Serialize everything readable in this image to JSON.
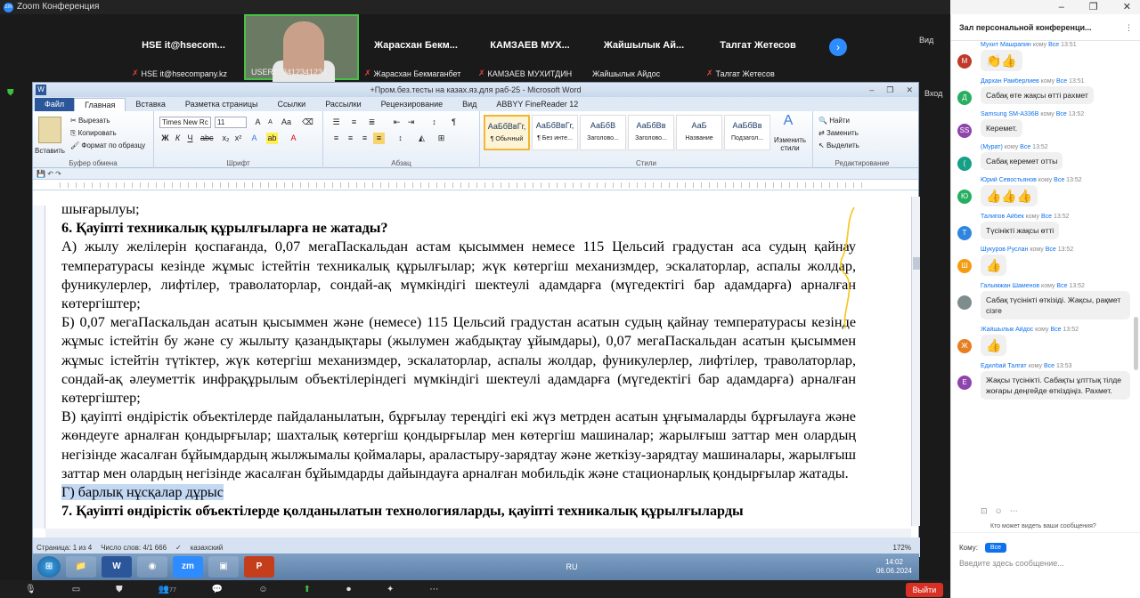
{
  "zoom": {
    "title": "Zoom Конференция",
    "view_label": "Вид",
    "exit_label": "Вход"
  },
  "participants": [
    {
      "name": "HSE  it@hsecom...",
      "label": "HSE  it@hsecompany.kz",
      "muted": true
    },
    {
      "name": "",
      "label": "USER123412341234",
      "muted": false,
      "video": true
    },
    {
      "name": "Жарасхан  Бекм...",
      "label": "Жарасхан Бекмаганбет",
      "muted": true
    },
    {
      "name": "КАМЗАЕВ  МУХ...",
      "label": "КАМЗАЕВ МУХИТДИН",
      "muted": true
    },
    {
      "name": "Жайшылык  Ай...",
      "label": "Жайшылык Айдос",
      "muted": false
    },
    {
      "name": "Талгат Жетесов",
      "label": "Талгат Жетесов",
      "muted": true
    }
  ],
  "word": {
    "title": "+Пром.без.тесты на казах.яз.для раб-25  -  Microsoft Word",
    "tabs": [
      "Файл",
      "Главная",
      "Вставка",
      "Разметка страницы",
      "Ссылки",
      "Рассылки",
      "Рецензирование",
      "Вид",
      "ABBYY FineReader 12"
    ],
    "clipboard": {
      "paste": "Вставить",
      "cut": "Вырезать",
      "copy": "Копировать",
      "format": "Формат по образцу",
      "group": "Буфер обмена"
    },
    "font": {
      "name": "Times New Rc",
      "size": "11",
      "group": "Шрифт"
    },
    "paragraph_group": "Абзац",
    "styles": [
      {
        "preview": "АаБбВвГг,",
        "name": "¶ Обычный",
        "selected": true
      },
      {
        "preview": "АаБбВвГг,",
        "name": "¶ Без инте...",
        "selected": false
      },
      {
        "preview": "АаБбВ",
        "name": "Заголово...",
        "selected": false
      },
      {
        "preview": "АаБбВв",
        "name": "Заголово...",
        "selected": false
      },
      {
        "preview": "АаБ",
        "name": "Название",
        "selected": false
      },
      {
        "preview": "АаБбВв",
        "name": "Подзагол...",
        "selected": false
      }
    ],
    "styles_group": "Стили",
    "change_styles": "Изменить стили",
    "editing": {
      "find": "Найти",
      "replace": "Заменить",
      "select": "Выделить",
      "group": "Редактирование"
    },
    "document": {
      "lines": [
        {
          "text": "шығарылуы;",
          "bold": false
        },
        {
          "text": "6. Қауіпті техникалық құрылғыларға не жатады?",
          "bold": true
        },
        {
          "text": "А) жылу желілерін қоспағанда, 0,07 мегаПаскальдан астам қысыммен немесе 115 Цельсий градустан аса судың қайнау температурасы кезінде жұмыс істейтін техникалық құрылғылар; жүк көтергіш механизмдер, эскалаторлар, аспалы жолдар, фуникулерлер, лифтілер, траволаторлар, сондай-ақ мүмкіндігі шектеулі адамдарға (мүгедектігі бар адамдарға) арналған көтергіштер;",
          "bold": false
        },
        {
          "text": "Б) 0,07 мегаПаскальдан асатын қысыммен және (немесе) 115 Цельсий градустан асатын судың қайнау температурасы кезінде жұмыс істейтін бу және су жылыту қазандықтары (жылумен жабдықтау ұйымдары), 0,07 мегаПаскальдан асатын қысыммен жұмыс істейтін түтіктер, жүк көтергіш механизмдер, эскалаторлар, аспалы жолдар, фуникулерлер, лифтілер, траволаторлар, сондай-ақ әлеуметтік инфрақұрылым объектілеріндегі мүмкіндігі шектеулі адамдарға (мүгедектігі бар адамдарға) арналған көтергіштер;",
          "bold": false
        },
        {
          "text": "В) қауіпті өндірістік объектілерде пайдаланылатын, бұрғылау тереңдігі екі жүз метрден асатын ұңғымаларды бұрғылауға және жөндеуге арналған қондырғылар; шахталық көтергіш қондырғылар мен көтергіш машиналар; жарылғыш заттар мен олардың негізінде жасалған бұйымдардың жылжымалы қоймалары, араластыру-зарядтау және жеткізу-зарядтау машиналары, жарылғыш заттар мен олардың негізінде жасалған бұйымдарды дайындауға арналған мобильдік және стационарлық қондырғылар жатады.",
          "bold": false
        },
        {
          "text": "Г) барлық нұсқалар дұрыс",
          "bold": false,
          "highlight": true
        },
        {
          "text": "7. Қауіпті өндірістік объектілерде қолданылатын технологияларды, қауіпті техникалық құрылғыларды",
          "bold": true
        }
      ]
    },
    "status": {
      "page": "Страница: 1 из 4",
      "words": "Число слов: 4/1 666",
      "lang": "казахский",
      "zoom": "172%"
    }
  },
  "taskbar": {
    "apps": [
      "",
      "",
      "W",
      "",
      "zm",
      "",
      "P"
    ],
    "lang": "RU",
    "time": "14:02",
    "date": "06.06.2024"
  },
  "zoom_toolbar": {
    "participants_count": "77",
    "exit": "Выйти"
  },
  "chat": {
    "title": "Зал персональной конференци...",
    "messages": [
      {
        "sender": "Мухит Машрапин",
        "to": "кому",
        "all": "Все",
        "time": "13:51",
        "avatar": "М",
        "color": "#c0392b",
        "text": "👏👍",
        "emoji": true
      },
      {
        "sender": "Дархан Рамберлиев",
        "to": "кому",
        "all": "Все",
        "time": "13:51",
        "avatar": "Д",
        "color": "#27ae60",
        "text": "Сабақ өте жақсы өтті рахмет",
        "emoji": false
      },
      {
        "sender": "Samsung SM-A336B",
        "to": "кому",
        "all": "Все",
        "time": "13:52",
        "avatar": "SS",
        "color": "#8e44ad",
        "text": "Керемет.",
        "emoji": false
      },
      {
        "sender": "(Мурат)",
        "to": "кому",
        "all": "Все",
        "time": "13:52",
        "avatar": "(",
        "color": "#16a085",
        "text": "Сабақ керемет отты",
        "emoji": false
      },
      {
        "sender": "Юрий Севостьянов",
        "to": "кому",
        "all": "Все",
        "time": "13:52",
        "avatar": "Ю",
        "color": "#27ae60",
        "text": "👍👍👍",
        "emoji": true
      },
      {
        "sender": "Талипов Айбек",
        "to": "кому",
        "all": "Все",
        "time": "13:52",
        "avatar": "Т",
        "color": "#2e86de",
        "text": "Түсінікті жақсы өтті",
        "emoji": false
      },
      {
        "sender": "Шукуров Руслан",
        "to": "кому",
        "all": "Все",
        "time": "13:52",
        "avatar": "Ш",
        "color": "#f39c12",
        "text": "👍",
        "emoji": true
      },
      {
        "sender": "Галымжан Шаменов",
        "to": "кому",
        "all": "Все",
        "time": "13:52",
        "avatar": "",
        "color": "#7f8c8d",
        "text": "Сабақ түсінікті өткізіді. Жақсы, рақмет сізге",
        "emoji": false
      },
      {
        "sender": "Жайшылык Айдос",
        "to": "кому",
        "all": "Все",
        "time": "13:52",
        "avatar": "Ж",
        "color": "#e67e22",
        "text": "👍",
        "emoji": true
      },
      {
        "sender": "Едилбай Талгат",
        "to": "кому",
        "all": "Все",
        "time": "13:53",
        "avatar": "Е",
        "color": "#8e44ad",
        "text": "Жақсы түсінікті. Сабақты ұлттық тілде жоғары деңгейде өткіздіңіз. Рахмет.",
        "emoji": false
      }
    ],
    "who_can_see": "Кто может видеть ваши сообщения?",
    "to_label": "Кому:",
    "to_value": "Все",
    "input_placeholder": "Введите здесь сообщение..."
  }
}
